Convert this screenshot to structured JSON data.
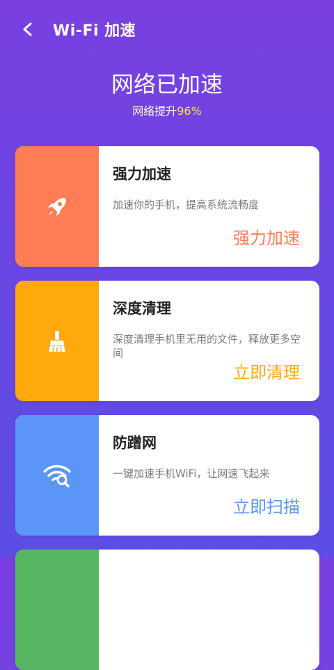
{
  "topbar": {
    "back_icon": "chevron-left-icon",
    "title": "Wi-Fi 加速"
  },
  "hero": {
    "title": "网络已加速",
    "subtitle_prefix": "网络提升",
    "subtitle_value": "96%",
    "value_color": "#ffe14d"
  },
  "cards": [
    {
      "title": "强力加速",
      "description": "加速你的手机，提高系统流畅度",
      "action": "强力加速",
      "accent": "#ff7d55",
      "icon": "rocket-icon"
    },
    {
      "title": "深度清理",
      "description": "深度清理手机里无用的文件，释放更多空间",
      "action": "立即清理",
      "accent": "#ffa90c",
      "icon": "broom-icon"
    },
    {
      "title": "防蹭网",
      "description": "一键加速手机WiFi，让网速飞起来",
      "action": "立即扫描",
      "accent": "#5b95f7",
      "icon": "wifi-scan-icon"
    },
    {
      "accent": "#57b662"
    }
  ]
}
